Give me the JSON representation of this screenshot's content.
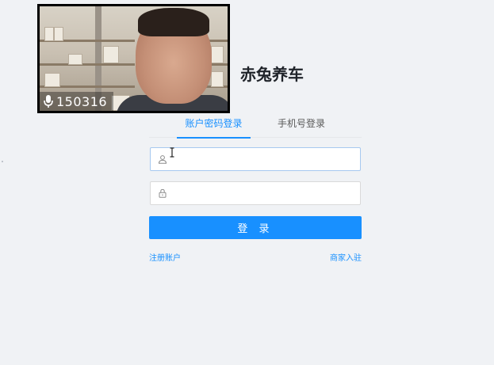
{
  "webcam": {
    "room_number": "150316",
    "mic_icon": "microphone-icon"
  },
  "brand": {
    "title": "赤兔养车"
  },
  "tabs": [
    {
      "label": "账户密码登录",
      "active": true
    },
    {
      "label": "手机号登录",
      "active": false
    }
  ],
  "form": {
    "username": {
      "value": "",
      "placeholder": "",
      "icon": "user-icon"
    },
    "password": {
      "value": "",
      "placeholder": "",
      "icon": "lock-icon"
    },
    "submit_label": "登 录"
  },
  "links": {
    "register": "注册账户",
    "merchant": "商家入驻"
  },
  "colors": {
    "accent": "#1890ff",
    "background": "#f0f2f5",
    "title": "#1f2329"
  }
}
